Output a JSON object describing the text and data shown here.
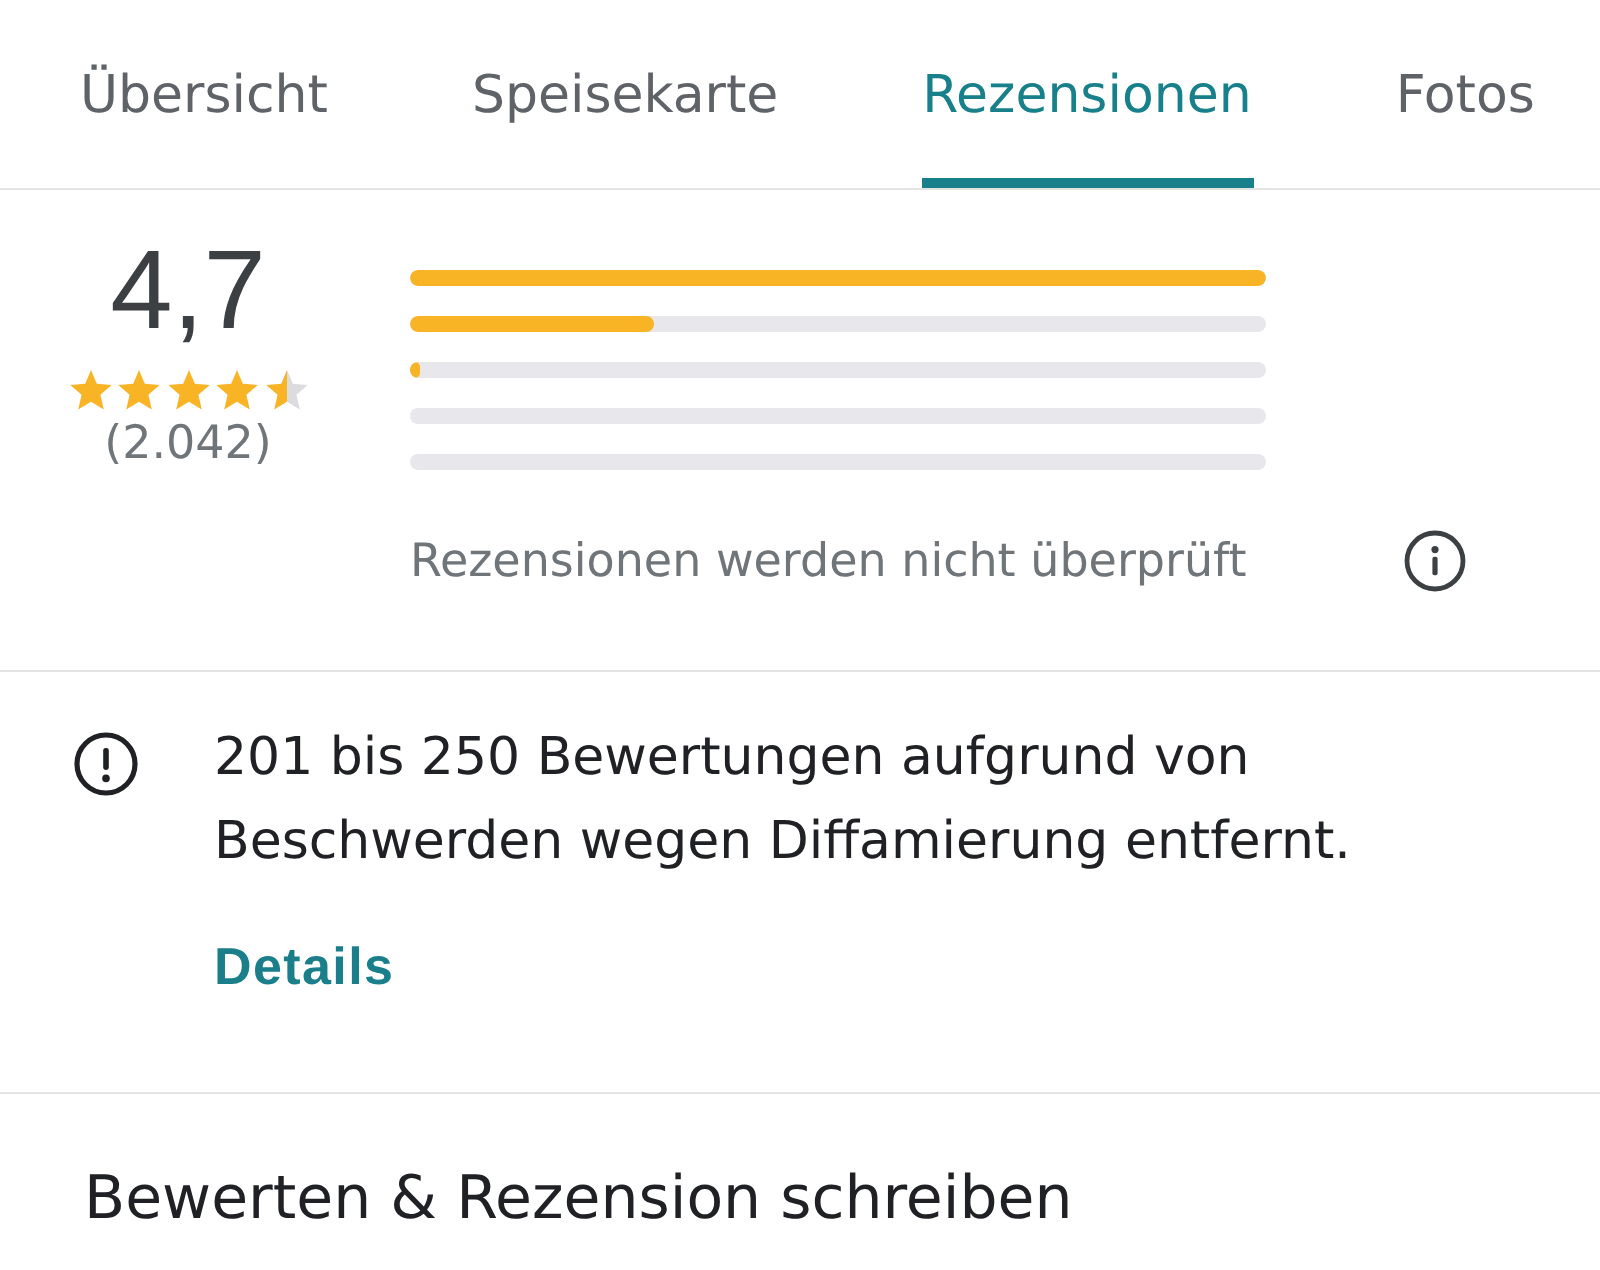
{
  "tabs": [
    {
      "label": "Übersicht",
      "selected": false
    },
    {
      "label": "Speisekarte",
      "selected": false
    },
    {
      "label": "Rezensionen",
      "selected": true
    },
    {
      "label": "Fotos",
      "selected": false
    }
  ],
  "rating": {
    "score": "4,7",
    "stars": 4.5,
    "count": "(2.042)",
    "distribution": [
      {
        "level": 1
      },
      {
        "level": 0.285
      },
      {
        "level": 0.012
      },
      {
        "level": 0
      },
      {
        "level": 0
      }
    ],
    "note": "Rezensionen werden nicht überprüft"
  },
  "notice": {
    "message": "201 bis 250 Bewertungen aufgrund von Beschwerden wegen Diffamierung entfernt.",
    "link": "Details"
  },
  "write_review": {
    "title": "Bewerten & Rezension schreiben"
  }
}
